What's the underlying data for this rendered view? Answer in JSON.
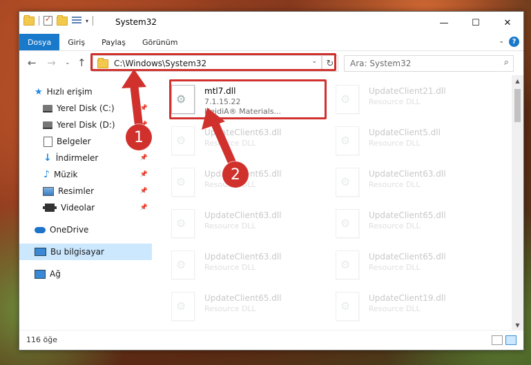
{
  "window": {
    "title": "System32"
  },
  "window_controls": {
    "minimize": "—",
    "maximize": "☐",
    "close": "✕"
  },
  "ribbon": {
    "tabs": [
      "Dosya",
      "Giriş",
      "Paylaş",
      "Görünüm"
    ],
    "help": "?"
  },
  "address": {
    "path": "C:\\Windows\\System32"
  },
  "search": {
    "placeholder": "Ara: System32"
  },
  "sidebar": {
    "items": [
      {
        "label": "Hızlı erişim"
      },
      {
        "label": "Yerel Disk (C:)"
      },
      {
        "label": "Yerel Disk (D:)"
      },
      {
        "label": "Belgeler"
      },
      {
        "label": "İndirmeler"
      },
      {
        "label": "Müzik"
      },
      {
        "label": "Resimler"
      },
      {
        "label": "Videolar"
      },
      {
        "label": "OneDrive"
      },
      {
        "label": "Bu bilgisayar"
      },
      {
        "label": "Ağ"
      }
    ]
  },
  "files": {
    "main": {
      "name": "mtl7.dll",
      "version": "7.1.15.22",
      "company": "HeidiA® Materials..."
    },
    "left": [
      {
        "name": "UpdateClient63.dll",
        "type": "Resource DLL"
      },
      {
        "name": "UpdateClient65.dll",
        "type": "Resource DLL"
      },
      {
        "name": "UpdateClient63.dll",
        "type": "Resource DLL"
      },
      {
        "name": "UpdateClient63.dll",
        "type": "Resource DLL"
      },
      {
        "name": "UpdateClient65.dll",
        "type": "Resource DLL"
      }
    ],
    "right": [
      {
        "name": "UpdateClient21.dll",
        "type": "Resource DLL"
      },
      {
        "name": "UpdateClient5.dll",
        "type": "Resource DLL"
      },
      {
        "name": "UpdateClient63.dll",
        "type": "Resource DLL"
      },
      {
        "name": "UpdateClient65.dll",
        "type": "Resource DLL"
      },
      {
        "name": "UpdateClient65.dll",
        "type": "Resource DLL"
      },
      {
        "name": "UpdateClient19.dll",
        "type": "Resource DLL"
      }
    ]
  },
  "status": {
    "count": "116 öğe"
  },
  "callouts": {
    "one": "1",
    "two": "2"
  },
  "colors": {
    "accent": "#1979ca",
    "highlight": "#d0312d",
    "selection": "#cce8ff"
  }
}
